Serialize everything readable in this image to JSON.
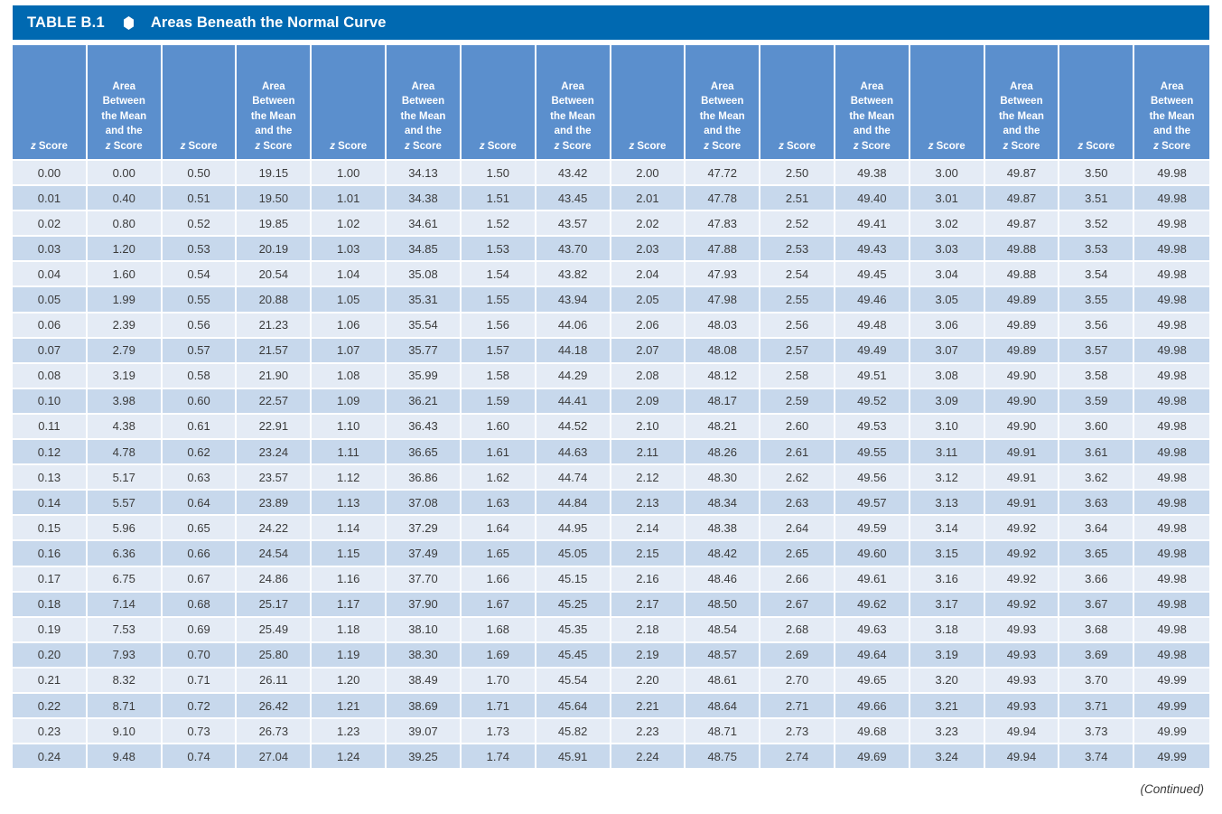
{
  "title": {
    "label": "TABLE B.1",
    "glyph": "diamond-bullet",
    "text": "Areas Beneath the Normal Curve"
  },
  "header": {
    "z_score": "z Score",
    "area_lines": [
      "Area",
      "Between",
      "the Mean",
      "and the"
    ],
    "area_last": "z Score"
  },
  "columns": [
    {
      "type": "z",
      "label": "z Score"
    },
    {
      "type": "area",
      "label": "Area Between the Mean and the z Score"
    },
    {
      "type": "z",
      "label": "z Score"
    },
    {
      "type": "area",
      "label": "Area Between the Mean and the z Score"
    },
    {
      "type": "z",
      "label": "z Score"
    },
    {
      "type": "area",
      "label": "Area Between the Mean and the z Score"
    },
    {
      "type": "z",
      "label": "z Score"
    },
    {
      "type": "area",
      "label": "Area Between the Mean and the z Score"
    },
    {
      "type": "z",
      "label": "z Score"
    },
    {
      "type": "area",
      "label": "Area Between the Mean and the z Score"
    },
    {
      "type": "z",
      "label": "z Score"
    },
    {
      "type": "area",
      "label": "Area Between the Mean and the z Score"
    },
    {
      "type": "z",
      "label": "z Score"
    },
    {
      "type": "area",
      "label": "Area Between the Mean and the z Score"
    },
    {
      "type": "z",
      "label": "z Score"
    },
    {
      "type": "area",
      "label": "Area Between the Mean and the z Score"
    }
  ],
  "rows": [
    [
      "0.00",
      "0.00",
      "0.50",
      "19.15",
      "1.00",
      "34.13",
      "1.50",
      "43.42",
      "2.00",
      "47.72",
      "2.50",
      "49.38",
      "3.00",
      "49.87",
      "3.50",
      "49.98"
    ],
    [
      "0.01",
      "0.40",
      "0.51",
      "19.50",
      "1.01",
      "34.38",
      "1.51",
      "43.45",
      "2.01",
      "47.78",
      "2.51",
      "49.40",
      "3.01",
      "49.87",
      "3.51",
      "49.98"
    ],
    [
      "0.02",
      "0.80",
      "0.52",
      "19.85",
      "1.02",
      "34.61",
      "1.52",
      "43.57",
      "2.02",
      "47.83",
      "2.52",
      "49.41",
      "3.02",
      "49.87",
      "3.52",
      "49.98"
    ],
    [
      "0.03",
      "1.20",
      "0.53",
      "20.19",
      "1.03",
      "34.85",
      "1.53",
      "43.70",
      "2.03",
      "47.88",
      "2.53",
      "49.43",
      "3.03",
      "49.88",
      "3.53",
      "49.98"
    ],
    [
      "0.04",
      "1.60",
      "0.54",
      "20.54",
      "1.04",
      "35.08",
      "1.54",
      "43.82",
      "2.04",
      "47.93",
      "2.54",
      "49.45",
      "3.04",
      "49.88",
      "3.54",
      "49.98"
    ],
    [
      "0.05",
      "1.99",
      "0.55",
      "20.88",
      "1.05",
      "35.31",
      "1.55",
      "43.94",
      "2.05",
      "47.98",
      "2.55",
      "49.46",
      "3.05",
      "49.89",
      "3.55",
      "49.98"
    ],
    [
      "0.06",
      "2.39",
      "0.56",
      "21.23",
      "1.06",
      "35.54",
      "1.56",
      "44.06",
      "2.06",
      "48.03",
      "2.56",
      "49.48",
      "3.06",
      "49.89",
      "3.56",
      "49.98"
    ],
    [
      "0.07",
      "2.79",
      "0.57",
      "21.57",
      "1.07",
      "35.77",
      "1.57",
      "44.18",
      "2.07",
      "48.08",
      "2.57",
      "49.49",
      "3.07",
      "49.89",
      "3.57",
      "49.98"
    ],
    [
      "0.08",
      "3.19",
      "0.58",
      "21.90",
      "1.08",
      "35.99",
      "1.58",
      "44.29",
      "2.08",
      "48.12",
      "2.58",
      "49.51",
      "3.08",
      "49.90",
      "3.58",
      "49.98"
    ],
    [
      "0.10",
      "3.98",
      "0.60",
      "22.57",
      "1.09",
      "36.21",
      "1.59",
      "44.41",
      "2.09",
      "48.17",
      "2.59",
      "49.52",
      "3.09",
      "49.90",
      "3.59",
      "49.98"
    ],
    [
      "0.11",
      "4.38",
      "0.61",
      "22.91",
      "1.10",
      "36.43",
      "1.60",
      "44.52",
      "2.10",
      "48.21",
      "2.60",
      "49.53",
      "3.10",
      "49.90",
      "3.60",
      "49.98"
    ],
    [
      "0.12",
      "4.78",
      "0.62",
      "23.24",
      "1.11",
      "36.65",
      "1.61",
      "44.63",
      "2.11",
      "48.26",
      "2.61",
      "49.55",
      "3.11",
      "49.91",
      "3.61",
      "49.98"
    ],
    [
      "0.13",
      "5.17",
      "0.63",
      "23.57",
      "1.12",
      "36.86",
      "1.62",
      "44.74",
      "2.12",
      "48.30",
      "2.62",
      "49.56",
      "3.12",
      "49.91",
      "3.62",
      "49.98"
    ],
    [
      "0.14",
      "5.57",
      "0.64",
      "23.89",
      "1.13",
      "37.08",
      "1.63",
      "44.84",
      "2.13",
      "48.34",
      "2.63",
      "49.57",
      "3.13",
      "49.91",
      "3.63",
      "49.98"
    ],
    [
      "0.15",
      "5.96",
      "0.65",
      "24.22",
      "1.14",
      "37.29",
      "1.64",
      "44.95",
      "2.14",
      "48.38",
      "2.64",
      "49.59",
      "3.14",
      "49.92",
      "3.64",
      "49.98"
    ],
    [
      "0.16",
      "6.36",
      "0.66",
      "24.54",
      "1.15",
      "37.49",
      "1.65",
      "45.05",
      "2.15",
      "48.42",
      "2.65",
      "49.60",
      "3.15",
      "49.92",
      "3.65",
      "49.98"
    ],
    [
      "0.17",
      "6.75",
      "0.67",
      "24.86",
      "1.16",
      "37.70",
      "1.66",
      "45.15",
      "2.16",
      "48.46",
      "2.66",
      "49.61",
      "3.16",
      "49.92",
      "3.66",
      "49.98"
    ],
    [
      "0.18",
      "7.14",
      "0.68",
      "25.17",
      "1.17",
      "37.90",
      "1.67",
      "45.25",
      "2.17",
      "48.50",
      "2.67",
      "49.62",
      "3.17",
      "49.92",
      "3.67",
      "49.98"
    ],
    [
      "0.19",
      "7.53",
      "0.69",
      "25.49",
      "1.18",
      "38.10",
      "1.68",
      "45.35",
      "2.18",
      "48.54",
      "2.68",
      "49.63",
      "3.18",
      "49.93",
      "3.68",
      "49.98"
    ],
    [
      "0.20",
      "7.93",
      "0.70",
      "25.80",
      "1.19",
      "38.30",
      "1.69",
      "45.45",
      "2.19",
      "48.57",
      "2.69",
      "49.64",
      "3.19",
      "49.93",
      "3.69",
      "49.98"
    ],
    [
      "0.21",
      "8.32",
      "0.71",
      "26.11",
      "1.20",
      "38.49",
      "1.70",
      "45.54",
      "2.20",
      "48.61",
      "2.70",
      "49.65",
      "3.20",
      "49.93",
      "3.70",
      "49.99"
    ],
    [
      "0.22",
      "8.71",
      "0.72",
      "26.42",
      "1.21",
      "38.69",
      "1.71",
      "45.64",
      "2.21",
      "48.64",
      "2.71",
      "49.66",
      "3.21",
      "49.93",
      "3.71",
      "49.99"
    ],
    [
      "0.23",
      "9.10",
      "0.73",
      "26.73",
      "1.23",
      "39.07",
      "1.73",
      "45.82",
      "2.23",
      "48.71",
      "2.73",
      "49.68",
      "3.23",
      "49.94",
      "3.73",
      "49.99"
    ],
    [
      "0.24",
      "9.48",
      "0.74",
      "27.04",
      "1.24",
      "39.25",
      "1.74",
      "45.91",
      "2.24",
      "48.75",
      "2.74",
      "49.69",
      "3.24",
      "49.94",
      "3.74",
      "49.99"
    ]
  ],
  "footer": {
    "continued": "(Continued)"
  },
  "colors": {
    "title_bar": "#0069B1",
    "header_cell": "#5B8FCD",
    "row_odd": "#E4EBF5",
    "row_even": "#C7D8EC",
    "text": "#3B3B3B",
    "header_text": "#FFFFFF"
  }
}
